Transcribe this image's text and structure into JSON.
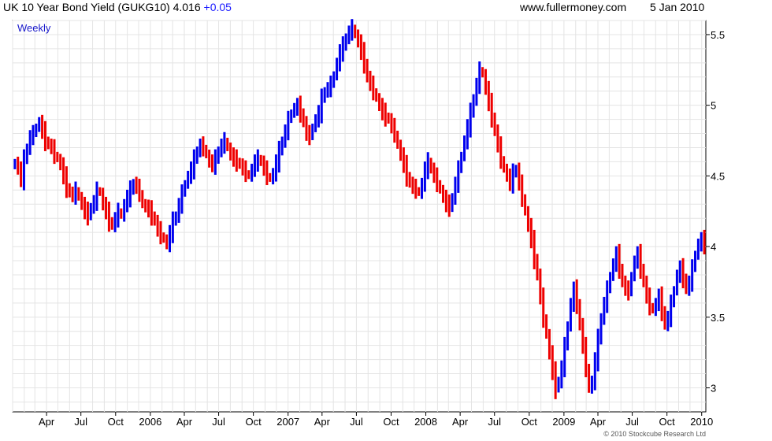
{
  "header": {
    "title": "UK 10 Year Bond Yield (GUKG10)",
    "last": "4.016",
    "change": "+0.05",
    "site": "www.fullermoney.com",
    "date": "5 Jan 2010"
  },
  "chart_data": {
    "type": "ohlc",
    "period_label": "Weekly",
    "copyright": "© 2010 Stockcube Research Ltd",
    "ylim": [
      2.83,
      5.6
    ],
    "y_ticks": [
      3,
      3.5,
      4,
      4.5,
      5,
      5.5
    ],
    "y_tick_labels": [
      "3",
      "3.5",
      "4",
      "4.5",
      "5",
      "5.5"
    ],
    "grid": true,
    "colors": {
      "up": "#0000ee",
      "down": "#ee0000",
      "grid": "#d8d8d8"
    },
    "x_ticks": [
      {
        "label": "Apr",
        "date": "2005-04-01"
      },
      {
        "label": "Jul",
        "date": "2005-07-01"
      },
      {
        "label": "Oct",
        "date": "2005-10-01"
      },
      {
        "label": "2006",
        "date": "2006-01-01"
      },
      {
        "label": "Apr",
        "date": "2006-04-01"
      },
      {
        "label": "Jul",
        "date": "2006-07-01"
      },
      {
        "label": "Oct",
        "date": "2006-10-01"
      },
      {
        "label": "2007",
        "date": "2007-01-01"
      },
      {
        "label": "Apr",
        "date": "2007-04-01"
      },
      {
        "label": "Jul",
        "date": "2007-07-01"
      },
      {
        "label": "Oct",
        "date": "2007-10-01"
      },
      {
        "label": "2008",
        "date": "2008-01-01"
      },
      {
        "label": "Apr",
        "date": "2008-04-01"
      },
      {
        "label": "Jul",
        "date": "2008-07-01"
      },
      {
        "label": "Oct",
        "date": "2008-10-01"
      },
      {
        "label": "2009",
        "date": "2009-01-01"
      },
      {
        "label": "Apr",
        "date": "2009-04-01"
      },
      {
        "label": "Jul",
        "date": "2009-07-01"
      },
      {
        "label": "Oct",
        "date": "2009-10-01"
      },
      {
        "label": "2010",
        "date": "2010-01-01"
      }
    ],
    "weeks": {
      "start": "2005-01-07",
      "end": "2010-01-08",
      "closes": [
        4.6,
        4.55,
        4.48,
        4.62,
        4.7,
        4.78,
        4.8,
        4.85,
        4.88,
        4.82,
        4.75,
        4.72,
        4.7,
        4.65,
        4.62,
        4.58,
        4.5,
        4.42,
        4.38,
        4.36,
        4.4,
        4.35,
        4.3,
        4.25,
        4.22,
        4.28,
        4.32,
        4.4,
        4.38,
        4.3,
        4.25,
        4.18,
        4.15,
        4.2,
        4.25,
        4.22,
        4.3,
        4.35,
        4.4,
        4.45,
        4.42,
        4.38,
        4.3,
        4.28,
        4.26,
        4.22,
        4.18,
        4.12,
        4.08,
        4.05,
        4.02,
        4.1,
        4.18,
        4.22,
        4.3,
        4.38,
        4.45,
        4.5,
        4.55,
        4.62,
        4.68,
        4.72,
        4.7,
        4.65,
        4.6,
        4.58,
        4.62,
        4.68,
        4.72,
        4.75,
        4.7,
        4.65,
        4.62,
        4.6,
        4.58,
        4.55,
        4.52,
        4.5,
        4.55,
        4.6,
        4.62,
        4.6,
        4.55,
        4.5,
        4.48,
        4.52,
        4.6,
        4.68,
        4.75,
        4.82,
        4.9,
        4.95,
        4.98,
        5.0,
        4.95,
        4.88,
        4.8,
        4.78,
        4.85,
        4.9,
        4.95,
        5.05,
        5.1,
        5.12,
        5.15,
        5.22,
        5.3,
        5.38,
        5.42,
        5.48,
        5.52,
        5.55,
        5.5,
        5.45,
        5.38,
        5.3,
        5.2,
        5.15,
        5.1,
        5.05,
        5.0,
        4.95,
        4.92,
        4.9,
        4.85,
        4.8,
        4.72,
        4.65,
        4.58,
        4.5,
        4.45,
        4.42,
        4.4,
        4.38,
        4.45,
        4.55,
        4.6,
        4.55,
        4.5,
        4.45,
        4.4,
        4.35,
        4.3,
        4.28,
        4.35,
        4.45,
        4.55,
        4.65,
        4.75,
        4.85,
        4.95,
        5.05,
        5.15,
        5.25,
        5.22,
        5.12,
        5.02,
        4.92,
        4.82,
        4.72,
        4.62,
        4.55,
        4.5,
        4.45,
        4.52,
        4.55,
        4.45,
        4.35,
        4.25,
        4.15,
        4.05,
        3.92,
        3.8,
        3.65,
        3.5,
        3.38,
        3.25,
        3.12,
        3.0,
        3.05,
        3.15,
        3.3,
        3.45,
        3.6,
        3.7,
        3.6,
        3.45,
        3.3,
        3.15,
        3.0,
        3.05,
        3.2,
        3.35,
        3.5,
        3.6,
        3.7,
        3.8,
        3.88,
        3.95,
        3.85,
        3.75,
        3.7,
        3.68,
        3.8,
        3.9,
        3.95,
        3.85,
        3.75,
        3.65,
        3.58,
        3.55,
        3.6,
        3.65,
        3.55,
        3.45,
        3.5,
        3.6,
        3.7,
        3.8,
        3.85,
        3.78,
        3.7,
        3.75,
        3.85,
        3.95,
        4.02,
        4.05,
        4.016
      ]
    }
  }
}
